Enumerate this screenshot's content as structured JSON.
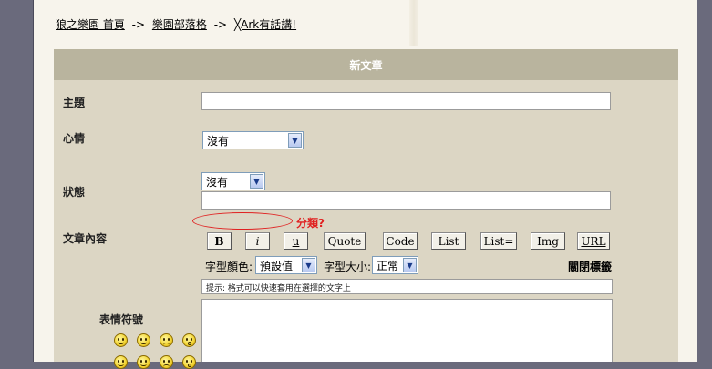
{
  "breadcrumb": {
    "home": "狼之樂園 首頁",
    "sep1": "->",
    "blog": "樂園部落格",
    "sep2": "->",
    "current": "╳Ark有話講!"
  },
  "form": {
    "header": "新文章",
    "subject_label": "主題",
    "subject_value": "",
    "mood_label": "心情",
    "mood_value": "沒有",
    "status_label": "狀態",
    "status_value": "沒有",
    "status_text_value": "",
    "content_label": "文章內容",
    "emoticon_label": "表情符號"
  },
  "annotation": {
    "text": "分類?",
    "color": "#e02020"
  },
  "toolbar": {
    "bold": "B",
    "italic": "i",
    "underline": "u",
    "quote": "Quote",
    "code": "Code",
    "list": "List",
    "list_eq": "List=",
    "img": "Img",
    "url": "URL"
  },
  "format": {
    "font_color_label": "字型顏色:",
    "font_color_value": "預設值",
    "font_size_label": "字型大小:",
    "font_size_value": "正常",
    "close_tags": "關閉標籤"
  },
  "hint": "提示: 格式可以快速套用在選擇的文字上",
  "emoticons": [
    "smile",
    "grin",
    "sad",
    "surprise",
    "smile",
    "grin",
    "sad",
    "surprise"
  ],
  "colors": {
    "background": "#6a6a7c",
    "panel": "#dcd6c4",
    "header": "#b9b49e"
  }
}
